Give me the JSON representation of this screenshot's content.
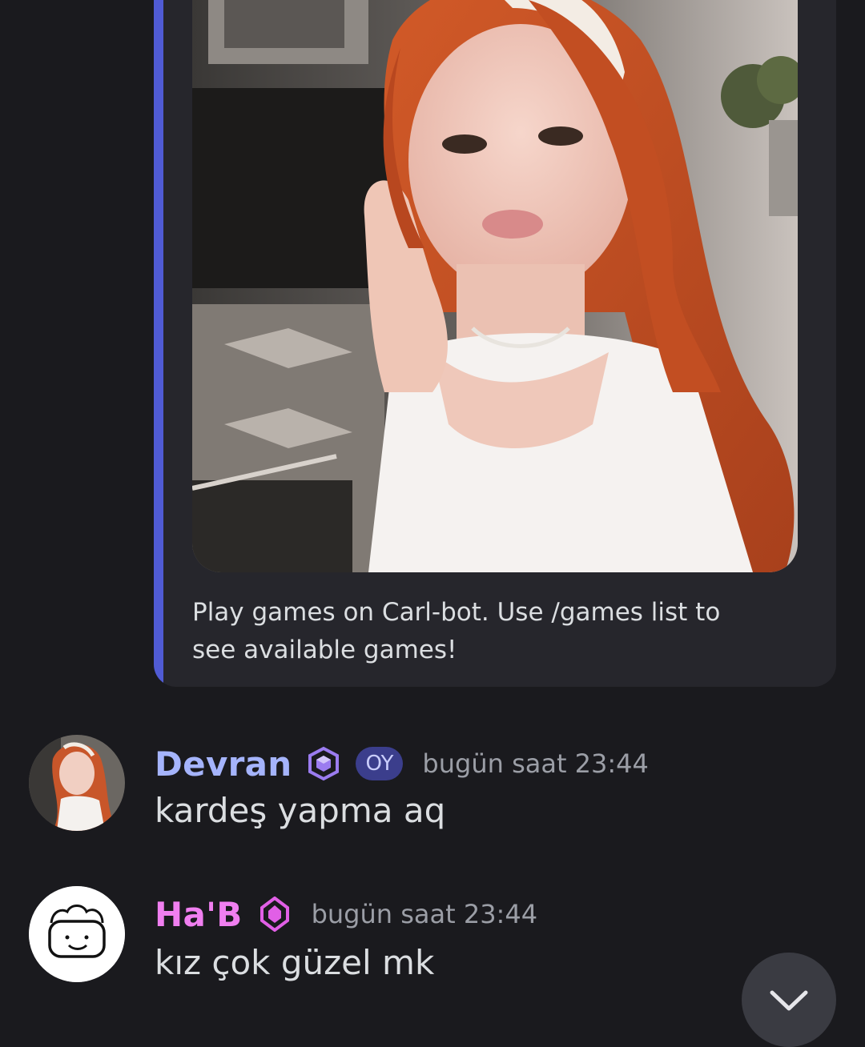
{
  "embed": {
    "description": "Play games on Carl-bot. Use /games list to see available games!",
    "accent_color": "#5865f2"
  },
  "messages": [
    {
      "username": "Devran",
      "username_color": "#a5b4fc",
      "role_icon": "cube-role-icon",
      "tag": "OY",
      "timestamp": "bugün saat 23:44",
      "text": "kardeş yapma aq"
    },
    {
      "username": "Ha'B",
      "username_color": "#f07ff0",
      "role_icon": "gem-role-icon",
      "timestamp": "bugün saat 23:44",
      "text": "kız çok güzel mk"
    }
  ],
  "scroll_button": {
    "icon": "chevron-down-icon"
  }
}
